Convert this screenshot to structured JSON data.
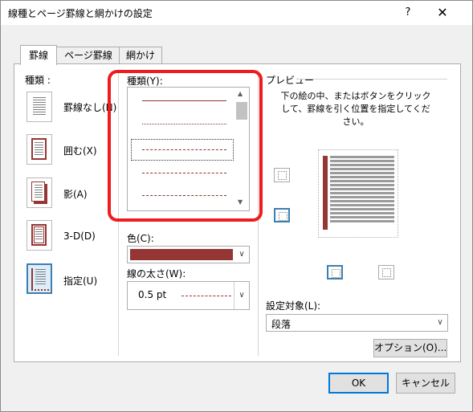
{
  "window": {
    "title": "線種とページ罫線と網かけの設定",
    "help_label": "?",
    "close_label": "✕"
  },
  "tabs": [
    {
      "label": "罫線",
      "active": true
    },
    {
      "label": "ページ罫線",
      "active": false
    },
    {
      "label": "網かけ",
      "active": false
    }
  ],
  "settings": {
    "heading": "種類 :",
    "items": [
      {
        "label": "罫線なし(N)",
        "icon": "no-border-icon"
      },
      {
        "label": "囲む(X)",
        "icon": "box-border-icon"
      },
      {
        "label": "影(A)",
        "icon": "shadow-border-icon"
      },
      {
        "label": "3-D(D)",
        "icon": "3d-border-icon"
      },
      {
        "label": "指定(U)",
        "icon": "custom-border-icon",
        "selected": true
      }
    ]
  },
  "style": {
    "label": "種類(Y):",
    "line_color": "#8b3232"
  },
  "color": {
    "label": "色(C):",
    "value": "#943634"
  },
  "width": {
    "label": "線の太さ(W):",
    "value": "0.5 pt"
  },
  "preview": {
    "heading": "プレビュー",
    "instruction": "下の絵の中、またはボタンをクリックして、罫線を引く位置を指定してください。",
    "border_color": "#943634"
  },
  "apply_to": {
    "label": "設定対象(L):",
    "value": "段落"
  },
  "buttons": {
    "options": "オプション(O)...",
    "ok": "OK",
    "cancel": "キャンセル"
  }
}
